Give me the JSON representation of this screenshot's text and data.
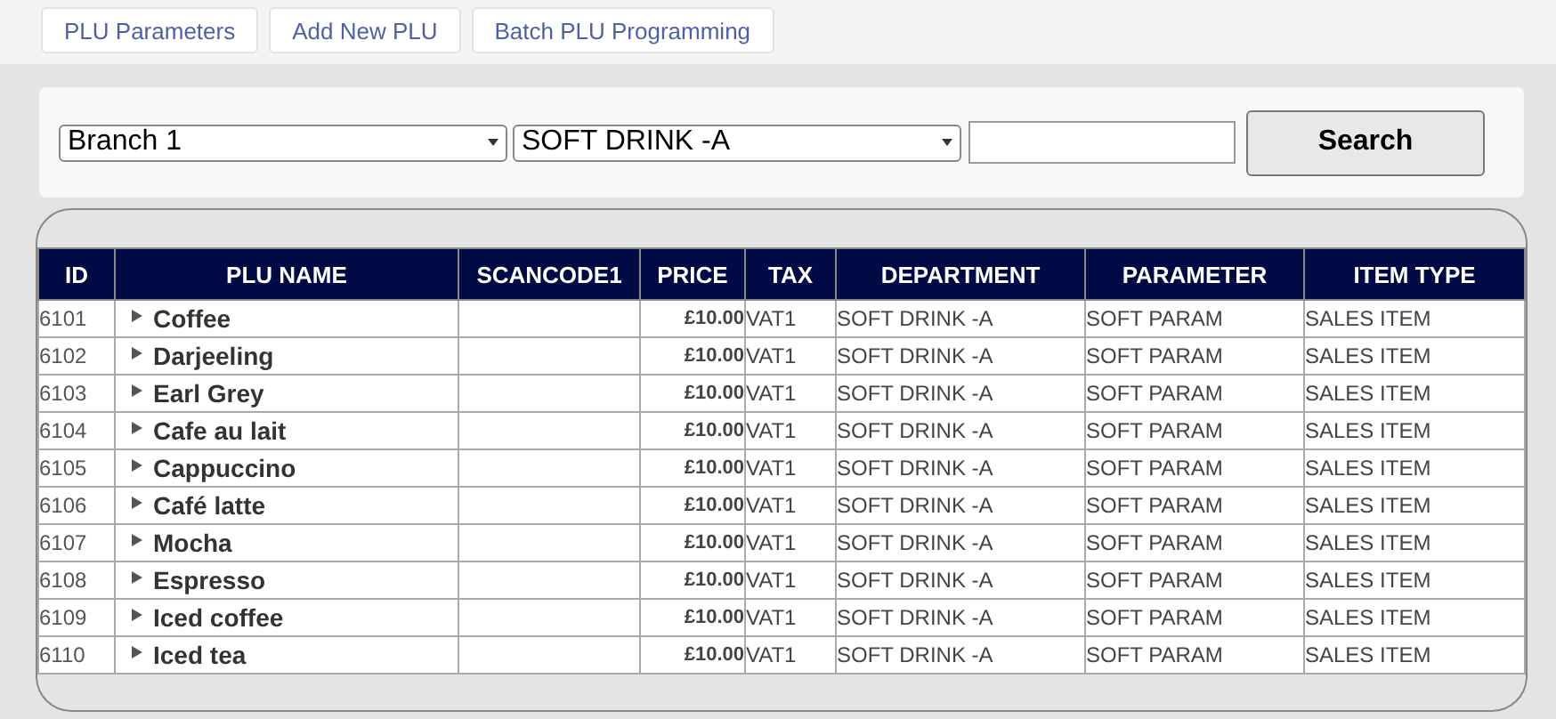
{
  "tabs": [
    {
      "label": "PLU Parameters"
    },
    {
      "label": "Add New PLU"
    },
    {
      "label": "Batch PLU Programming"
    }
  ],
  "filters": {
    "branch": "Branch 1",
    "department": "SOFT DRINK -A",
    "search_button": "Search"
  },
  "table": {
    "columns": [
      "ID",
      "PLU NAME",
      "SCANCODE1",
      "PRICE",
      "TAX",
      "DEPARTMENT",
      "PARAMETER",
      "ITEM TYPE"
    ],
    "rows": [
      {
        "id": "6101",
        "name": "Coffee",
        "price": "£10.00",
        "tax": "VAT1",
        "department": "SOFT DRINK -A",
        "parameter": "SOFT PARAM",
        "item_type": "SALES ITEM"
      },
      {
        "id": "6102",
        "name": "Darjeeling",
        "price": "£10.00",
        "tax": "VAT1",
        "department": "SOFT DRINK -A",
        "parameter": "SOFT PARAM",
        "item_type": "SALES ITEM"
      },
      {
        "id": "6103",
        "name": "Earl Grey",
        "price": "£10.00",
        "tax": "VAT1",
        "department": "SOFT DRINK -A",
        "parameter": "SOFT PARAM",
        "item_type": "SALES ITEM"
      },
      {
        "id": "6104",
        "name": "Cafe au lait",
        "price": "£10.00",
        "tax": "VAT1",
        "department": "SOFT DRINK -A",
        "parameter": "SOFT PARAM",
        "item_type": "SALES ITEM"
      },
      {
        "id": "6105",
        "name": "Cappuccino",
        "price": "£10.00",
        "tax": "VAT1",
        "department": "SOFT DRINK -A",
        "parameter": "SOFT PARAM",
        "item_type": "SALES ITEM"
      },
      {
        "id": "6106",
        "name": "Café latte",
        "price": "£10.00",
        "tax": "VAT1",
        "department": "SOFT DRINK -A",
        "parameter": "SOFT PARAM",
        "item_type": "SALES ITEM"
      },
      {
        "id": "6107",
        "name": "Mocha",
        "price": "£10.00",
        "tax": "VAT1",
        "department": "SOFT DRINK -A",
        "parameter": "SOFT PARAM",
        "item_type": "SALES ITEM"
      },
      {
        "id": "6108",
        "name": "Espresso",
        "price": "£10.00",
        "tax": "VAT1",
        "department": "SOFT DRINK -A",
        "parameter": "SOFT PARAM",
        "item_type": "SALES ITEM"
      },
      {
        "id": "6109",
        "name": "Iced coffee",
        "price": "£10.00",
        "tax": "VAT1",
        "department": "SOFT DRINK -A",
        "parameter": "SOFT PARAM",
        "item_type": "SALES ITEM"
      },
      {
        "id": "6110",
        "name": "Iced tea",
        "price": "£10.00",
        "tax": "VAT1",
        "department": "SOFT DRINK -A",
        "parameter": "SOFT PARAM",
        "item_type": "SALES ITEM"
      }
    ]
  }
}
